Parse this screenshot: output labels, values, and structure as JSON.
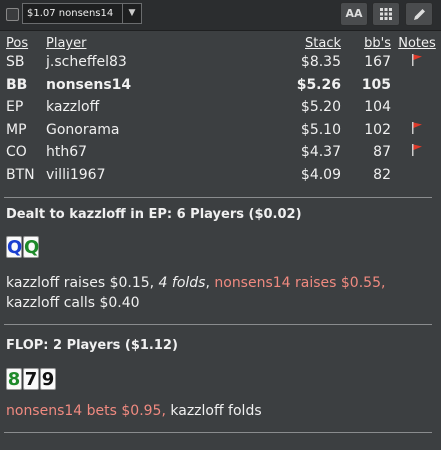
{
  "toolbar": {
    "hand_select_value": "$1.07 nonsens14",
    "btn_font": "AA",
    "icons": [
      "font-size-icon",
      "grid-icon",
      "pencil-icon"
    ]
  },
  "table": {
    "headers": {
      "pos": "Pos",
      "player": "Player",
      "stack": "Stack",
      "bbs": "bb's",
      "notes": "Notes"
    },
    "rows": [
      {
        "pos": "SB",
        "player": "j.scheffel83",
        "stack": "$8.35",
        "bbs": "167",
        "flag": true
      },
      {
        "pos": "BB",
        "player": "nonsens14",
        "stack": "$5.26",
        "bbs": "105",
        "flag": false,
        "hero": true
      },
      {
        "pos": "EP",
        "player": "kazzloff",
        "stack": "$5.20",
        "bbs": "104",
        "flag": false
      },
      {
        "pos": "MP",
        "player": "Gonorama",
        "stack": "$5.10",
        "bbs": "102",
        "flag": true
      },
      {
        "pos": "CO",
        "player": "hth67",
        "stack": "$4.37",
        "bbs": "87",
        "flag": true
      },
      {
        "pos": "BTN",
        "player": "villi1967",
        "stack": "$4.09",
        "bbs": "82",
        "flag": false
      }
    ]
  },
  "preflop": {
    "title": "Dealt to kazzloff in EP: 6 Players ($0.02)",
    "cards": [
      {
        "rank": "Q",
        "suit_color": "blue"
      },
      {
        "rank": "Q",
        "suit_color": "green"
      }
    ],
    "a1": "kazzloff raises $0.15, ",
    "a2": "4 folds",
    "a3": ", ",
    "a4": "nonsens14 raises $0.55,",
    "a5": "kazzloff calls $0.40"
  },
  "flop": {
    "title": "FLOP: 2 Players ($1.12)",
    "cards": [
      {
        "rank": "8",
        "suit_color": "green"
      },
      {
        "rank": "7",
        "suit_color": "black"
      },
      {
        "rank": "9",
        "suit_color": "black"
      }
    ],
    "a1": "nonsens14 bets $0.95,",
    "a2": " kazzloff folds"
  },
  "colors": {
    "background": "#3c3f41",
    "highlight": "#f08a80",
    "flag": "#e03a2a"
  }
}
